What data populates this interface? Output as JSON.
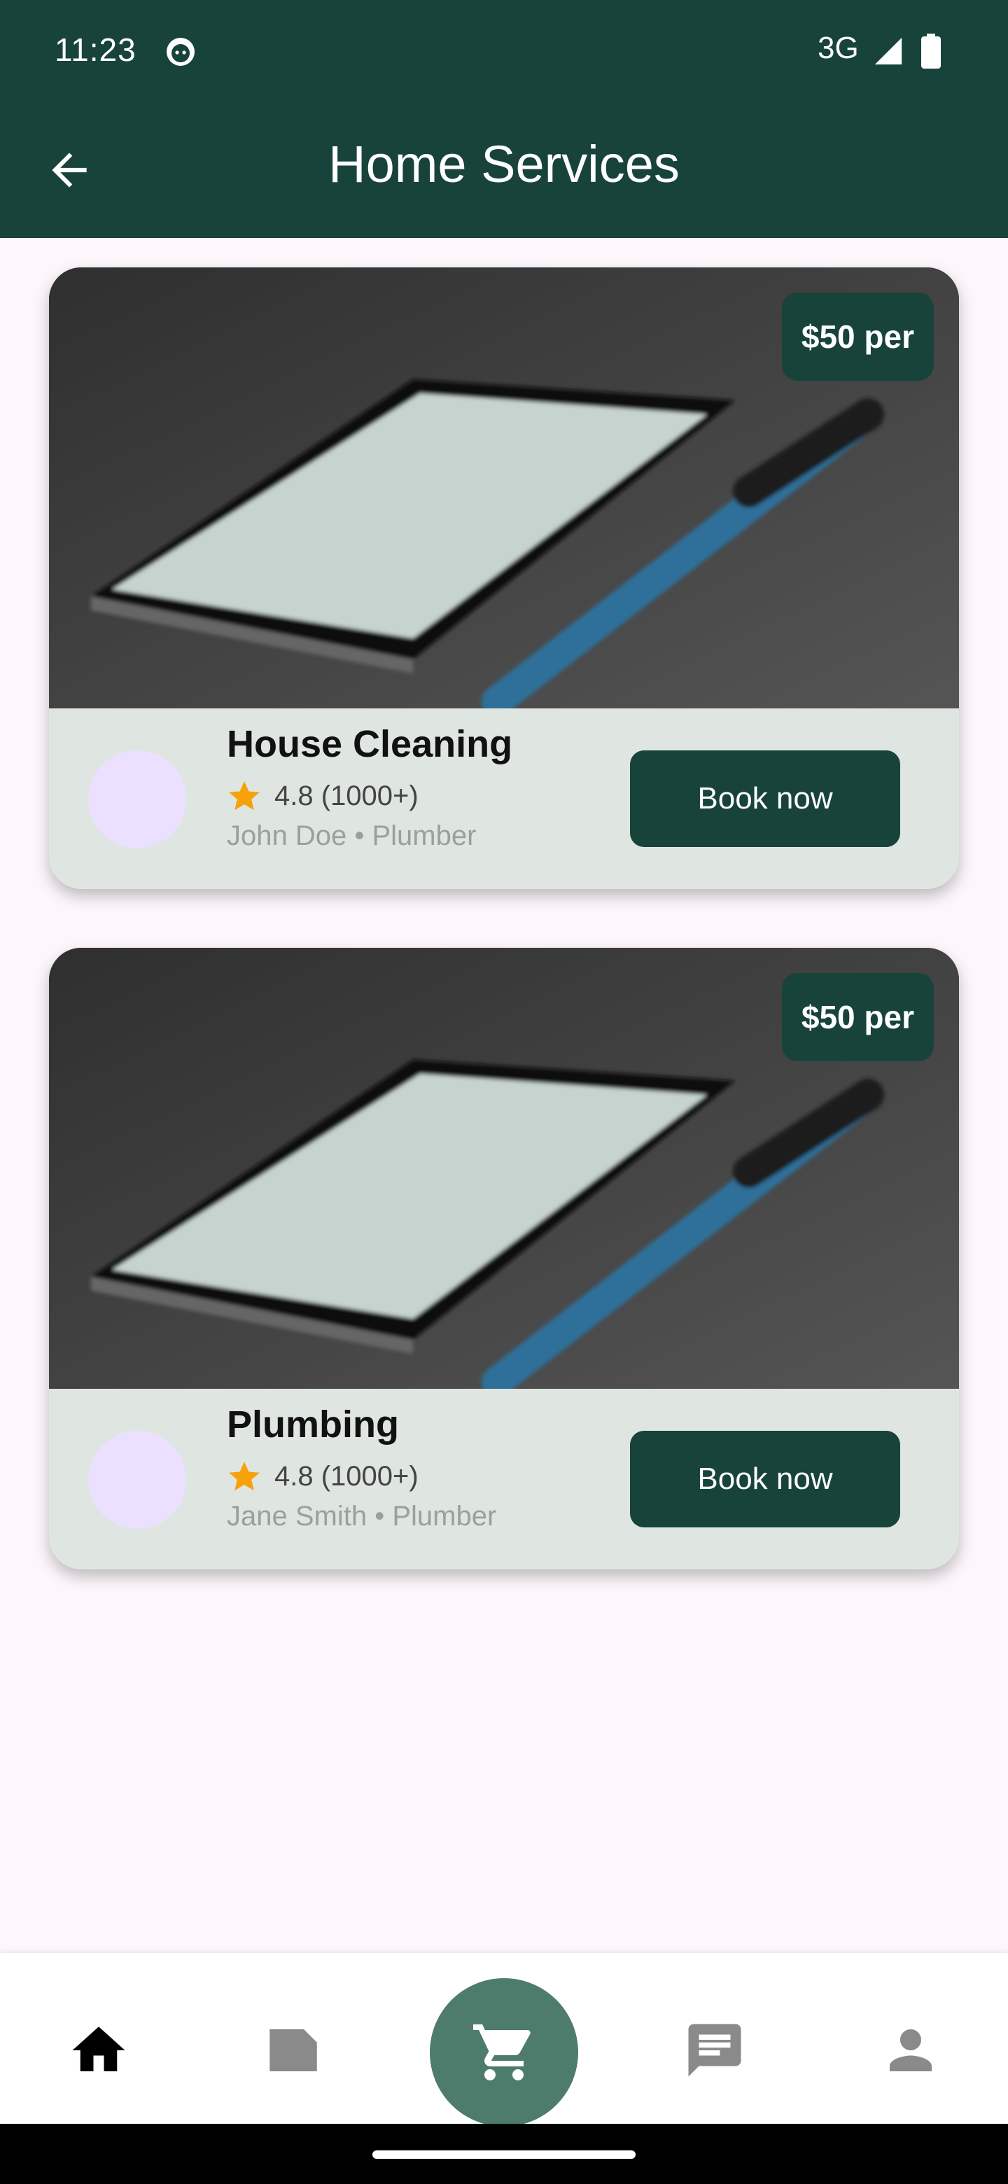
{
  "status_bar": {
    "time": "11:23",
    "network": "3G"
  },
  "app_bar": {
    "title": "Home Services"
  },
  "services": [
    {
      "price": "$50 per",
      "name": "House Cleaning",
      "rating": "4.8 (1000+)",
      "provider": "John Doe • Plumber",
      "book_label": "Book now"
    },
    {
      "price": "$50 per",
      "name": "Plumbing",
      "rating": "4.8 (1000+)",
      "provider": "Jane Smith • Plumber",
      "book_label": "Book now"
    }
  ],
  "bottom_nav": {
    "items": [
      "home-icon",
      "folder-icon",
      "cart-icon",
      "chat-icon",
      "person-icon"
    ],
    "selected": "home-icon"
  },
  "colors": {
    "primary": "#17433b",
    "card_bg": "#dfe6e1",
    "fab": "#4d7c6d",
    "star": "#f5a20b",
    "avatar": "#ebe0ff"
  }
}
